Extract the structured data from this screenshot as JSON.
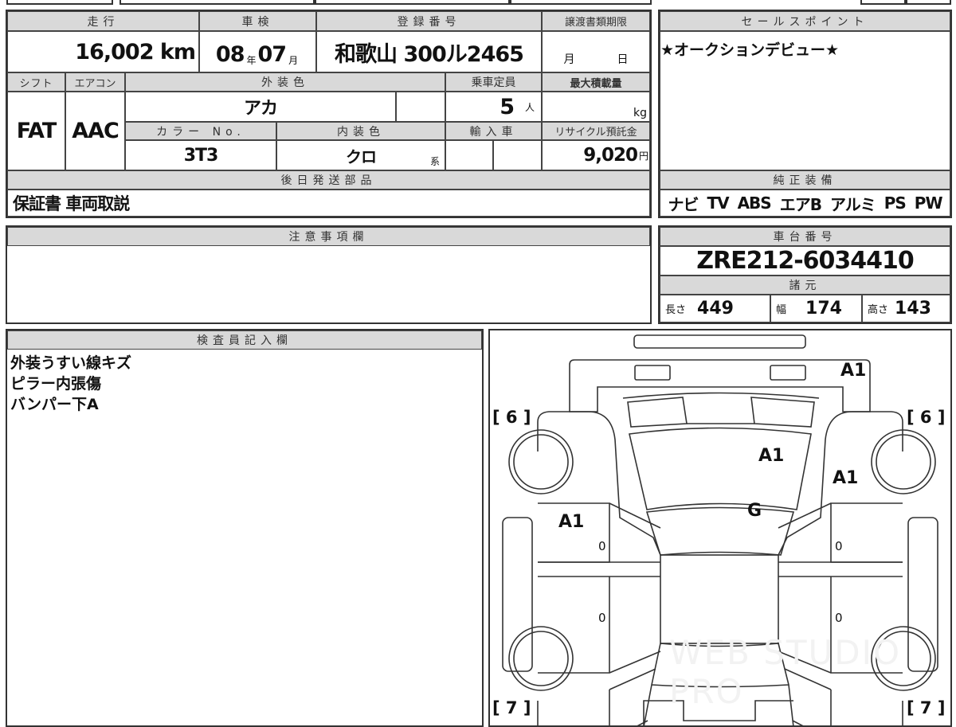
{
  "headers": {
    "mileage": "走行",
    "inspection": "車検",
    "registration": "登録番号",
    "transfer_deadline": "譲渡書類期限",
    "shift": "シフト",
    "aircon": "エアコン",
    "exterior_color": "外装色",
    "capacity": "乗車定員",
    "max_load": "最大積載量",
    "color_no": "カラー No.",
    "interior_color": "内装色",
    "import": "輸入車",
    "recycle_fee": "リサイクル預託金",
    "later_parts": "後日発送部品",
    "notes": "注意事項欄",
    "inspector": "検査員記入欄",
    "sales_point": "セールスポイント",
    "equipment": "純正装備",
    "chassis_no": "車台番号",
    "specs": "諸元"
  },
  "values": {
    "mileage": "16,002",
    "mileage_unit": "km",
    "insp_year": "08",
    "year_unit": "年",
    "insp_month": "07",
    "month_unit": "月",
    "registration": "和歌山 300ル2465",
    "deadline_month": "月",
    "deadline_day": "日",
    "shift": "FAT",
    "aircon": "AAC",
    "exterior_color": "アカ",
    "capacity": "5",
    "capacity_unit": "人",
    "max_load_unit": "kg",
    "color_no": "3T3",
    "interior_color": "クロ",
    "interior_suffix": "系",
    "recycle_fee": "9,020",
    "yen": "円",
    "later_parts": "保証書 車両取説",
    "sales_point": "★オークションデビュー★",
    "chassis_no": "ZRE212-6034410"
  },
  "equipment": [
    "ナビ",
    "TV",
    "ABS",
    "エアB",
    "アルミ",
    "PS",
    "PW"
  ],
  "specs": {
    "length_label": "長さ",
    "length": "449",
    "width_label": "幅",
    "width": "174",
    "height_label": "高さ",
    "height": "143"
  },
  "inspector_notes": [
    "外装うすい線キズ",
    "ピラー内張傷",
    "バンパー下A"
  ],
  "diagram": {
    "marks": {
      "rear_bumper": "A1",
      "rear_glass": "A1",
      "right_quarter": "A1",
      "roof": "G",
      "left_rear_door": "A1"
    },
    "tires": [
      "0",
      "0",
      "0",
      "0"
    ],
    "corner_front": "[ 6 ]",
    "corner_rear": "[ 7 ]",
    "watermark": "WEB STUDIO PRO"
  }
}
